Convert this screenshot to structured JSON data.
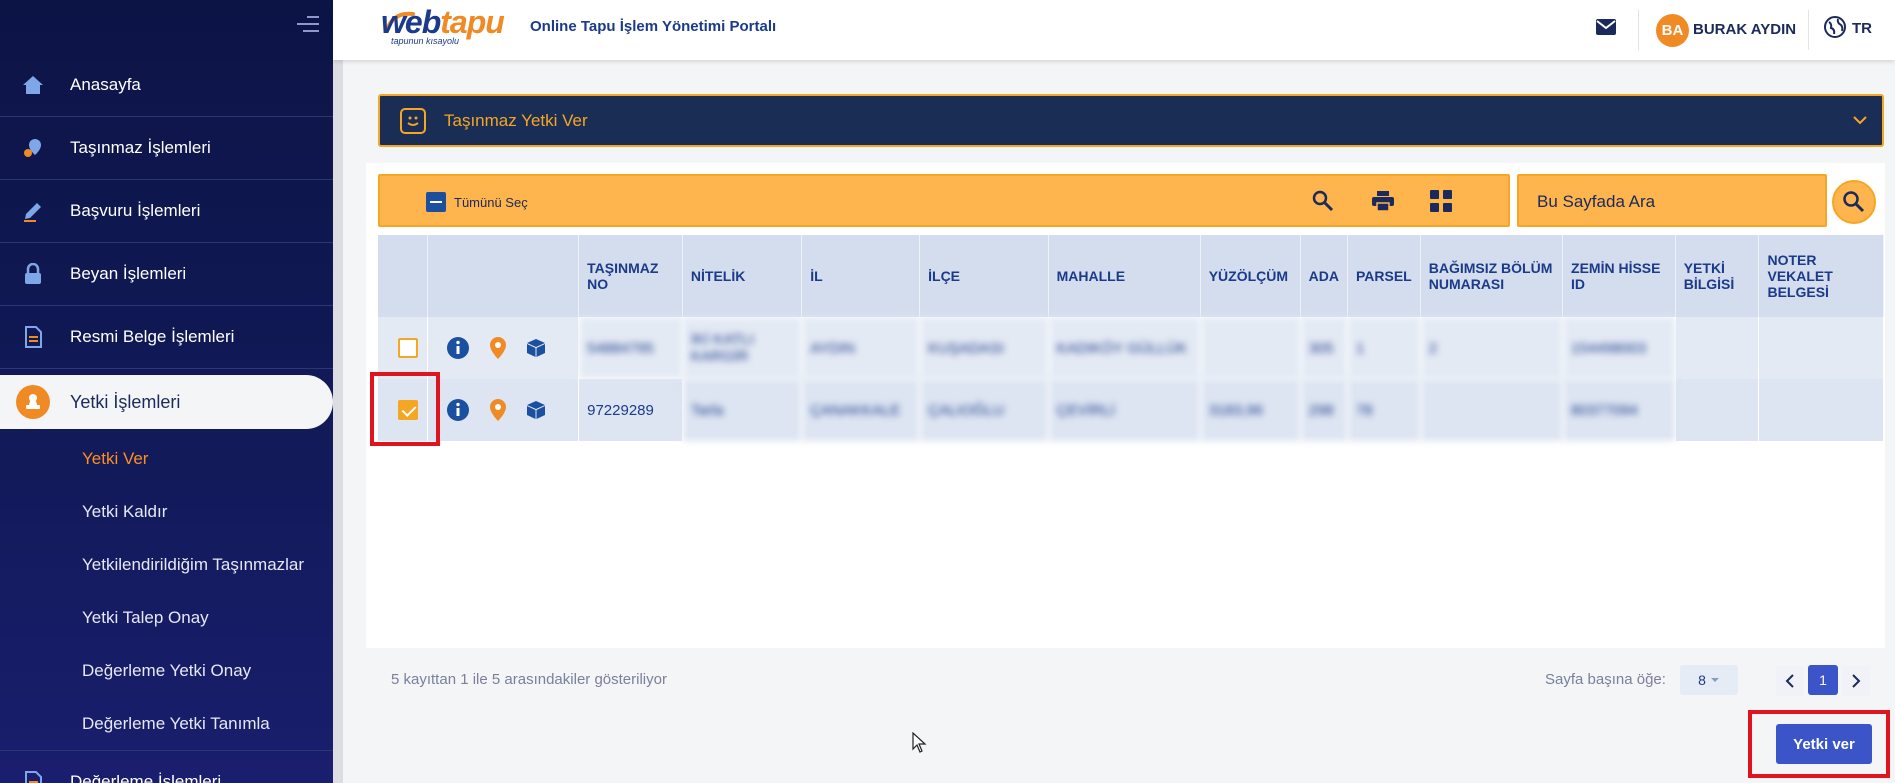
{
  "sidebar": {
    "items": [
      {
        "label": "Anasayfa",
        "icon": "home-icon"
      },
      {
        "label": "Taşınmaz İşlemleri",
        "icon": "map-pin-icon"
      },
      {
        "label": "Başvuru İşlemleri",
        "icon": "pen-icon"
      },
      {
        "label": "Beyan İşlemleri",
        "icon": "lock-icon"
      },
      {
        "label": "Resmi Belge İşlemleri",
        "icon": "document-icon"
      },
      {
        "label": "Yetki İşlemleri",
        "icon": "stamp-icon"
      }
    ],
    "subitems": [
      {
        "label": "Yetki Ver",
        "active": true
      },
      {
        "label": "Yetki Kaldır"
      },
      {
        "label": "Yetkilendirildiğim Taşınmazlar"
      },
      {
        "label": "Yetki Talep Onay"
      },
      {
        "label": "Değerleme Yetki Onay"
      },
      {
        "label": "Değerleme Yetki Tanımla"
      }
    ],
    "bottom_item": {
      "label": "Değerleme İşlemleri",
      "icon": "document-icon"
    }
  },
  "header": {
    "logo_web": "web",
    "logo_tapu": "tapu",
    "logo_slogan": "tapunun kısayolu",
    "portal_title": "Online Tapu İşlem Yönetimi Portalı",
    "avatar_initials": "BA",
    "username": "BURAK AYDIN",
    "language": "TR"
  },
  "panel": {
    "title": "Taşınmaz Yetki Ver"
  },
  "toolbar": {
    "select_all_label": "Tümünü Seç",
    "search_placeholder": "Bu Sayfada Ara"
  },
  "table": {
    "columns": [
      "TAŞINMAZ NO",
      "NİTELİK",
      "İL",
      "İLÇE",
      "MAHALLE",
      "YÜZÖLÇÜM",
      "ADA",
      "PARSEL",
      "BAĞIMSIZ BÖLÜM NUMARASI",
      "ZEMİN HİSSE ID",
      "YETKİ BİLGİSİ",
      "NOTER VEKALET BELGESİ"
    ],
    "rows": [
      {
        "checked": false,
        "tasinmaz_no": "54884795",
        "nitelik": "İKİ KATLI KARGİR",
        "il": "AYDIN",
        "ilce": "KUŞADASI",
        "mahalle": "KADIKÖY GÜLLÜK",
        "yuzolcum": "",
        "ada": "305",
        "parsel": "1",
        "bagimsiz": "2",
        "zemin": "154498003",
        "yetki": "",
        "noter": ""
      },
      {
        "checked": true,
        "tasinmaz_no": "97229289",
        "nitelik": "Tarla",
        "il": "ÇANAKKALE",
        "ilce": "ÇALIOĞLU",
        "mahalle": "ÇEVİRLİ",
        "yuzolcum": "3183,96",
        "ada": "298",
        "parsel": "78",
        "bagimsiz": "",
        "zemin": "80377094",
        "yetki": "",
        "noter": ""
      }
    ]
  },
  "footer": {
    "info": "5 kayıttan 1 ile 5 arasındakiler gösteriliyor",
    "per_page_label": "Sayfa başına öğe:",
    "per_page_value": "8",
    "current_page": "1",
    "submit_label": "Yetki ver"
  }
}
